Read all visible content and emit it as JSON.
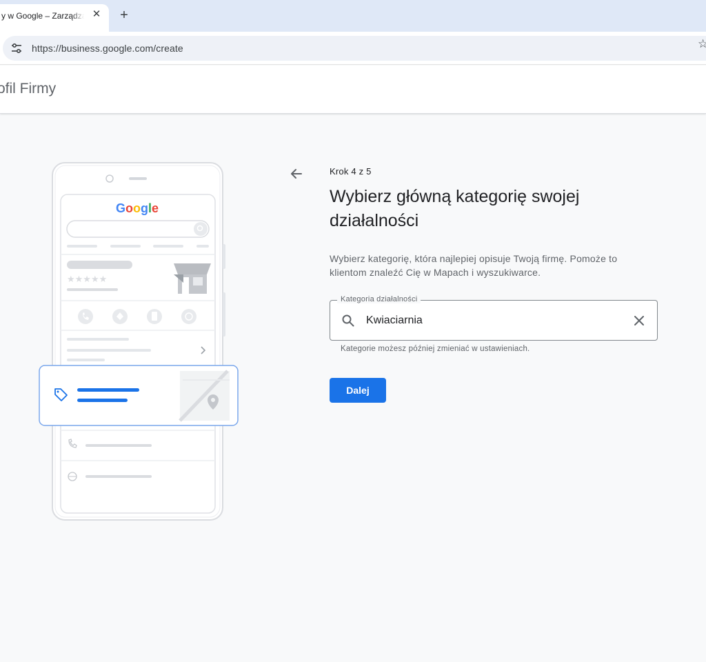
{
  "browser": {
    "tab_title": "y w Google – Zarządzaj",
    "url": "https://business.google.com/create",
    "icons": {
      "tab_close": "close-icon",
      "new_tab": "plus-icon",
      "site_settings": "tune-icon",
      "bookmark": "star-icon"
    }
  },
  "app": {
    "title": "ofil Firmy"
  },
  "illustration": {
    "brand": "Google"
  },
  "form": {
    "step": "Krok 4 z 5",
    "heading": "Wybierz główną kategorię swojej działalności",
    "description": "Wybierz kategorię, która najlepiej opisuje Twoją firmę. Pomoże to klientom znaleźć Cię w Mapach i wyszukiwarce.",
    "field": {
      "label": "Kategoria działalności",
      "value": "Kwiaciarnia"
    },
    "helper": "Kategorie możesz później zmieniać w ustawieniach.",
    "next_label": "Dalej"
  },
  "colors": {
    "accent": "#1a73e8",
    "tabstrip": "#dfe8f7",
    "page_background": "#f8f9fa"
  }
}
